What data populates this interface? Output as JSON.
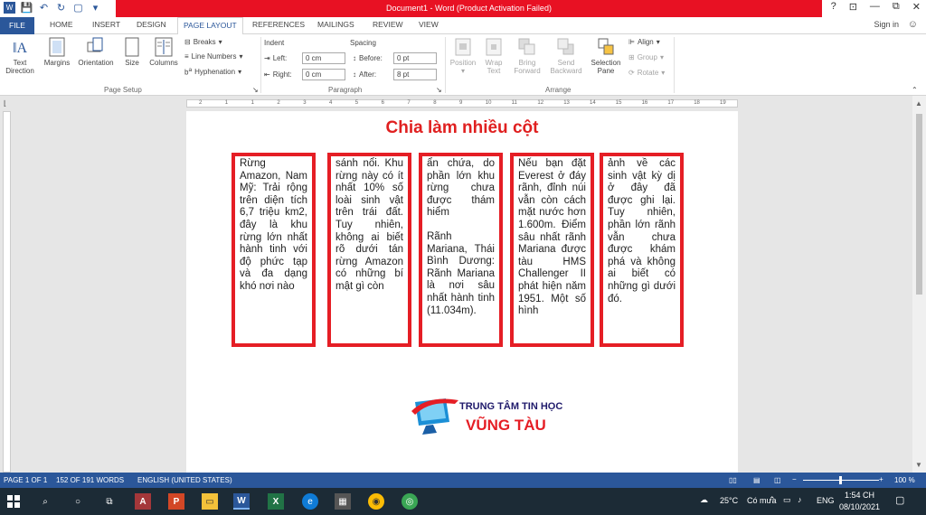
{
  "window": {
    "title": "Document1 - Word (Product Activation Failed)",
    "controls": [
      "?",
      "⊡",
      "—",
      "⧉",
      "✕"
    ]
  },
  "tabs": [
    "FILE",
    "HOME",
    "INSERT",
    "DESIGN",
    "PAGE LAYOUT",
    "REFERENCES",
    "MAILINGS",
    "REVIEW",
    "VIEW"
  ],
  "active_tab": "PAGE LAYOUT",
  "signin": "Sign in",
  "ribbon": {
    "page_setup": {
      "label": "Page Setup",
      "text_direction": "Text Direction",
      "margins": "Margins",
      "orientation": "Orientation",
      "size": "Size",
      "columns": "Columns",
      "breaks": "Breaks",
      "line_numbers": "Line Numbers",
      "hyphenation": "Hyphenation"
    },
    "paragraph": {
      "label": "Paragraph",
      "indent": "Indent",
      "spacing": "Spacing",
      "left_label": "Left:",
      "left_value": "0 cm",
      "right_label": "Right:",
      "right_value": "0 cm",
      "before_label": "Before:",
      "before_value": "0 pt",
      "after_label": "After:",
      "after_value": "8 pt"
    },
    "arrange": {
      "label": "Arrange",
      "position": "Position",
      "wrap_text": "Wrap Text",
      "bring_forward": "Bring Forward",
      "send_backward": "Send Backward",
      "selection_pane": "Selection Pane",
      "align": "Align",
      "group": "Group",
      "rotate": "Rotate"
    }
  },
  "ruler_numbers": [
    "2",
    "1",
    "1",
    "2",
    "3",
    "4",
    "5",
    "6",
    "7",
    "8",
    "9",
    "10",
    "11",
    "12",
    "13",
    "14",
    "15",
    "16",
    "17",
    "18",
    "19"
  ],
  "document": {
    "title": "Chia làm nhiều cột",
    "columns": [
      {
        "paras": [
          "Rừng Amazon, Nam Mỹ: Trải rộng trên diện tích 6,7 triệu km2, đây là khu rừng lớn nhất hành tinh với độ phức tạp và đa dạng khó nơi nào"
        ]
      },
      {
        "paras": [
          "sánh nổi. Khu rừng này có ít nhất 10% số loài sinh vật trên trái đất. Tuy nhiên, không ai biết rõ dưới tán rừng Amazon có những bí mật gì còn"
        ]
      },
      {
        "paras": [
          "ẩn chứa, do phần lớn khu rừng chưa được thám hiểm",
          "Rãnh Mariana, Thái Bình Dương: Rãnh Mariana là nơi sâu nhất hành tinh (11.034m)."
        ]
      },
      {
        "paras": [
          "Nếu bạn đặt Everest ở đáy rãnh, đỉnh núi vẫn còn cách mặt nước hơn 1.600m. Điểm sâu nhất rãnh Mariana được tàu HMS Challenger II phát hiện năm 1951. Một số hình"
        ]
      },
      {
        "paras": [
          "ảnh về các sinh vật kỳ dị ở đây đã được ghi lại. Tuy nhiên, phần lớn rãnh vẫn chưa được khám phá và không ai biết có những gì dưới đó."
        ]
      }
    ],
    "logo_line1": "TRUNG TÂM TIN HỌC",
    "logo_line2": "VŨNG TÀU"
  },
  "status": {
    "page": "PAGE 1 OF 1",
    "words": "152 OF 191 WORDS",
    "language": "ENGLISH (UNITED STATES)",
    "zoom": "100 %"
  },
  "taskbar": {
    "weather": "25°C",
    "weather_desc": "Có mưa",
    "lang": "ENG",
    "time": "1:54 CH",
    "date": "08/10/2021",
    "apps": [
      "start",
      "search",
      "task-view",
      "snip",
      "access",
      "powerpoint",
      "explorer",
      "word",
      "excel",
      "edge",
      "calculator",
      "chrome",
      "app"
    ]
  },
  "colors": {
    "accent": "#2b579a",
    "title_bar_red": "#e81123",
    "column_border": "#e51e25",
    "doc_title": "#e02020",
    "taskbar": "#1c2b36"
  }
}
